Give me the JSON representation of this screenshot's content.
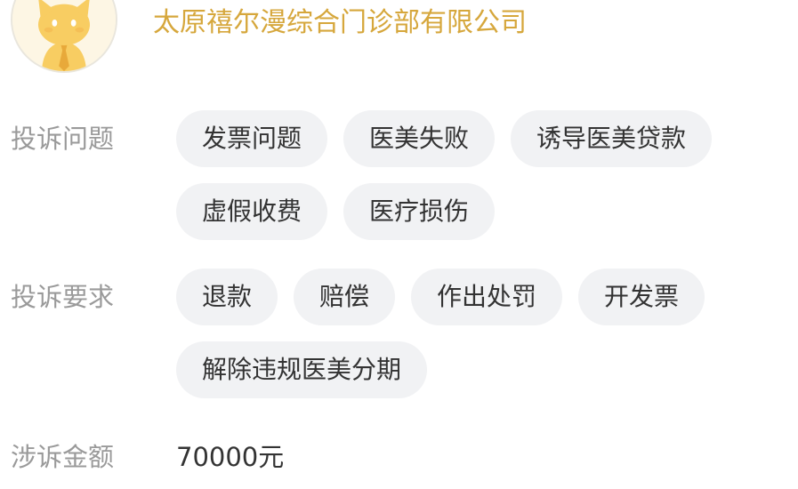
{
  "company": {
    "name": "太原禧尔漫综合门诊部有限公司"
  },
  "avatar": {
    "icon": "cat-mascot-icon",
    "colors": {
      "background": "#fdf6e4",
      "cat": "#f8cd62",
      "tie": "#e8a93a"
    }
  },
  "complaint_issues": {
    "label": "投诉问题",
    "tags": [
      {
        "label": "发票问题"
      },
      {
        "label": "医美失败"
      },
      {
        "label": "诱导医美贷款"
      },
      {
        "label": "虚假收费"
      },
      {
        "label": "医疗损伤"
      }
    ]
  },
  "complaint_demands": {
    "label": "投诉要求",
    "tags": [
      {
        "label": "退款"
      },
      {
        "label": "赔偿"
      },
      {
        "label": "作出处罚"
      },
      {
        "label": "开发票"
      },
      {
        "label": "解除违规医美分期"
      }
    ]
  },
  "amount": {
    "label": "涉诉金额",
    "value": "70000元"
  },
  "colors": {
    "accent": "#d6a73c",
    "label": "#9a9a9a",
    "text": "#333333",
    "tag_background": "#f1f2f4"
  }
}
